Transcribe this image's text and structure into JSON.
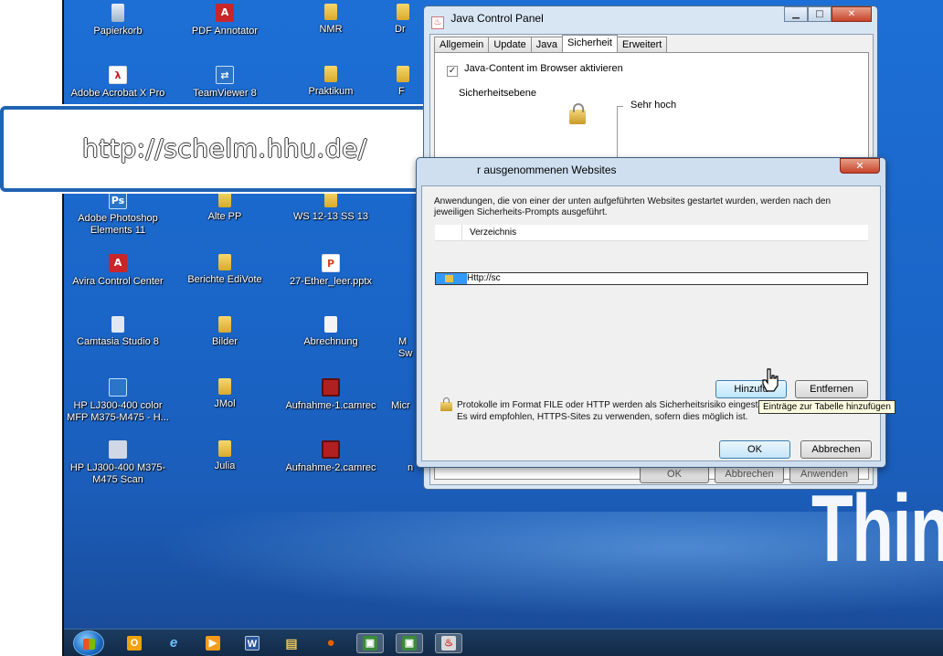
{
  "desktop": {
    "icons": [
      {
        "label": "Papierkorb",
        "icon": "recycle-bin-icon"
      },
      {
        "label": "PDF Annotator",
        "icon": "pdf-annotator-icon"
      },
      {
        "label": "NMR",
        "icon": "folder-icon"
      },
      {
        "label": "Dr",
        "icon": "folder-icon"
      },
      {
        "label": "Adobe Acrobat X Pro",
        "icon": "acrobat-icon"
      },
      {
        "label": "TeamViewer 8",
        "icon": "teamviewer-icon"
      },
      {
        "label": "Praktikum",
        "icon": "folder-icon"
      },
      {
        "label": "F",
        "icon": "folder-icon"
      },
      {
        "label": "Adobe Photoshop Elements 11",
        "icon": "photoshop-icon"
      },
      {
        "label": "Alte PP",
        "icon": "folder-icon"
      },
      {
        "label": "WS 12-13 SS 13",
        "icon": "folder-icon"
      },
      {
        "label": "Avira Control Center",
        "icon": "avira-icon"
      },
      {
        "label": "Berichte EdiVote",
        "icon": "folder-icon"
      },
      {
        "label": "27-Ether_leer.pptx",
        "icon": "powerpoint-file-icon"
      },
      {
        "label": "Camtasia Studio 8",
        "icon": "camtasia-icon"
      },
      {
        "label": "Bilder",
        "icon": "folder-icon"
      },
      {
        "label": "Abrechnung",
        "icon": "document-icon"
      },
      {
        "label": "M Sw",
        "icon": "folder-icon"
      },
      {
        "label": "HP LJ300-400 color MFP M375-M475 - H...",
        "icon": "printer-icon"
      },
      {
        "label": "JMol",
        "icon": "folder-icon"
      },
      {
        "label": "Aufnahme-1.camrec",
        "icon": "camrec-file-icon"
      },
      {
        "label": "Micr",
        "icon": "app-icon"
      },
      {
        "label": "HP LJ300-400 M375-M475 Scan",
        "icon": "scanner-icon"
      },
      {
        "label": "Julia",
        "icon": "folder-icon"
      },
      {
        "label": "Aufnahme-2.camrec",
        "icon": "camrec-file-icon"
      },
      {
        "label": "n",
        "icon": "app-icon"
      }
    ],
    "overlay_url": "http://schelm.hhu.de/",
    "brand_text": "Think"
  },
  "java_control_panel": {
    "title": "Java Control Panel",
    "tabs": [
      "Allgemein",
      "Update",
      "Java",
      "Sicherheit",
      "Erweitert"
    ],
    "active_tab": "Sicherheit",
    "checkbox_label": "Java-Content im Browser aktivieren",
    "checkbox_checked": true,
    "security_level_label": "Sicherheitsebene",
    "level_high_label": "Sehr hoch",
    "buttons": {
      "ok": "OK",
      "cancel": "Abbrechen",
      "apply": "Anwenden"
    }
  },
  "exception_dialog": {
    "title": "r ausgenommenen Websites",
    "description": "Anwendungen, die von einer der unten aufgeführten Websites gestartet wurden, werden nach den jeweiligen Sicherheits-Prompts ausgeführt.",
    "column_header": "Verzeichnis",
    "rows": [
      {
        "url": "Http://sc"
      }
    ],
    "add_button": "Hinzufü",
    "remove_button": "Entfernen",
    "warning_line1": "Protokolle im Format FILE oder HTTP werden als Sicherheitsrisiko eingestu",
    "warning_line2": "Es wird empfohlen, HTTPS-Sites zu verwenden, sofern dies möglich ist.",
    "ok_button": "OK",
    "cancel_button": "Abbrechen",
    "tooltip": "Einträge zur Tabelle hinzufügen"
  },
  "taskbar": {
    "items": [
      {
        "icon": "outlook-icon",
        "glyph": "O",
        "color": "#f0a30a"
      },
      {
        "icon": "internet-explorer-icon",
        "glyph": "e",
        "color": "#1e90ff"
      },
      {
        "icon": "media-player-icon",
        "glyph": "▶",
        "color": "#f59b1b"
      },
      {
        "icon": "word-icon",
        "glyph": "W",
        "color": "#2b579a"
      },
      {
        "icon": "file-explorer-icon",
        "glyph": "▤",
        "color": "#e8c35a"
      },
      {
        "icon": "firefox-icon",
        "glyph": "●",
        "color": "#e66000"
      },
      {
        "icon": "camtasia-recorder-icon",
        "glyph": "▣",
        "color": "#3b8a3b"
      },
      {
        "icon": "camtasia-studio-icon",
        "glyph": "▣",
        "color": "#3b8a3b"
      },
      {
        "icon": "java-icon",
        "glyph": "♨",
        "color": "#d9d9d9"
      }
    ]
  }
}
